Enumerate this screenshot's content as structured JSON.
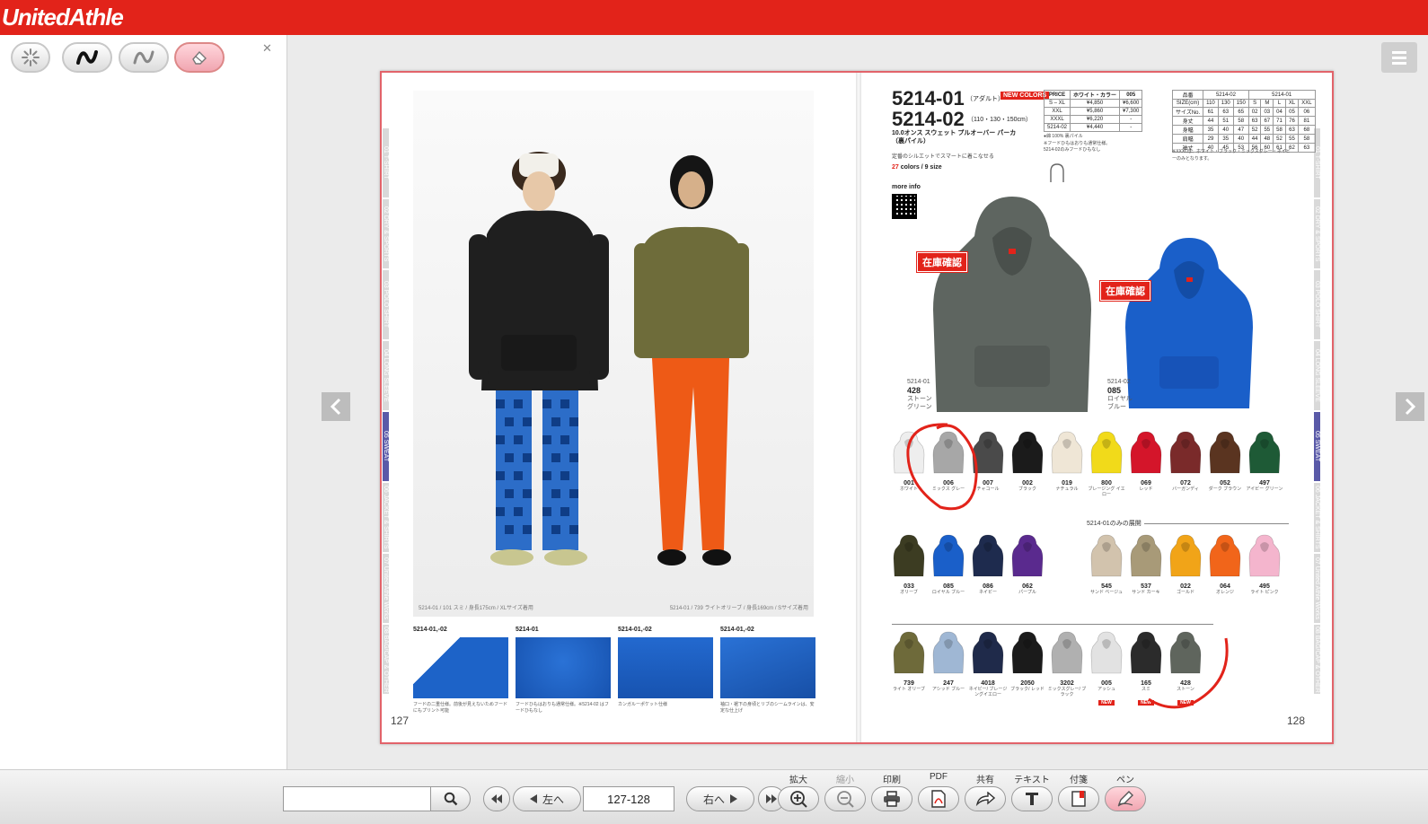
{
  "brand": "UnitedAthle",
  "book": {
    "left_tabs": [
      "01 T-SHIRT",
      "02 DRY & SPORTS",
      "03 POLO SHIRT",
      "04 LONG SLEEVE",
      "05 SWEAT",
      "06 JACKET & SHIRTS",
      "07 United Athle Works",
      "08 BAG/CAP & OTHER"
    ],
    "right_tabs": [
      "01 T-SHIRT",
      "02 DRY & SPORTS",
      "03 POLO SHIRT",
      "04 LONG SLEEVE",
      "05 SWEAT",
      "06 JACKET & SHIRTS",
      "07 United Athle Works",
      "08 BAG/CAP & OTHER"
    ],
    "left_page": {
      "caption_left": "5214-01 / 101 スミ / 身長175cm / XLサイズ着用",
      "caption_right": "5214-01 / 739 ライトオリーブ / 身長169cm / Sサイズ着用",
      "details": [
        {
          "label": "5214-01,-02",
          "text": "フードの二重仕様。前後が見えないためフードにもプリント可能"
        },
        {
          "label": "5214-01",
          "text": "フードひもはおりも通常仕様。※5214-02 はフードひもなし"
        },
        {
          "label": "5214-01,-02",
          "text": "カンガルーポケット仕様"
        },
        {
          "label": "5214-01,-02",
          "text": "袖口・裾下の身頃とリブのシームラインは、安定な仕上げ"
        }
      ],
      "page_number": "127"
    },
    "right_page": {
      "code1": "5214-01",
      "adult": "（アダルト）",
      "new_colors": "NEW COLORS",
      "code2": "5214-02",
      "sizes": "（110・130・150cm）",
      "desc": "10.0オンス スウェット プルオーバー パーカ（裏パイル）",
      "desc2": "定番のシルエットでスマートに着こなせる",
      "colors_count": "27",
      "colors_text": "colors / 9 size",
      "more_info": "more info",
      "price_table": [
        [
          "PRICE",
          "ホワイト・カラー",
          "005"
        ],
        [
          "S – XL",
          "¥4,850",
          "¥6,600"
        ],
        [
          "XXL",
          "¥5,860",
          "¥7,300"
        ],
        [
          "XXXL",
          "¥6,220",
          "-"
        ],
        [
          "5214-02",
          "¥4,440",
          "-"
        ]
      ],
      "notes": [
        "●綿 100% 裏パイル",
        "※フードひもはおりも通常仕様。",
        "5214-02のみフードひもなし"
      ],
      "size_table_header": [
        "品番",
        "5214-02",
        "5214-01"
      ],
      "size_table_rows": [
        [
          "SIZE(cm)",
          "110",
          "130",
          "150",
          "S",
          "M",
          "L",
          "XL",
          "XXL"
        ],
        [
          "サイズNo.",
          "61",
          "63",
          "65",
          "02",
          "03",
          "04",
          "05",
          "06"
        ],
        [
          "身丈",
          "44",
          "51",
          "58",
          "63",
          "67",
          "71",
          "76",
          "81"
        ],
        [
          "身幅",
          "35",
          "40",
          "47",
          "52",
          "55",
          "58",
          "63",
          "68"
        ],
        [
          "肩幅",
          "29",
          "35",
          "40",
          "44",
          "48",
          "52",
          "55",
          "58"
        ],
        [
          "袖丈",
          "40",
          "45",
          "53",
          "56",
          "60",
          "61",
          "62",
          "63"
        ]
      ],
      "size_note": "※XXXLは、ホワイト・ブラック・ミックスグレー・ネイビーのみとなります。",
      "stock_label": "在庫確認",
      "feature_left": {
        "code": "5214-01",
        "num": "428",
        "name": "ストーン グリーン"
      },
      "feature_right": {
        "code": "5214-02",
        "num": "085",
        "name": "ロイヤル ブルー"
      },
      "row1": [
        {
          "num": "001",
          "name": "ホワイト",
          "color": "#eeeeee"
        },
        {
          "num": "006",
          "name": "ミックス グレー",
          "color": "#a7a7a7"
        },
        {
          "num": "007",
          "name": "チャコール",
          "color": "#4a4a4a"
        },
        {
          "num": "002",
          "name": "ブラック",
          "color": "#1b1b1b"
        },
        {
          "num": "019",
          "name": "ナチュラル",
          "color": "#efe6d6"
        },
        {
          "num": "800",
          "name": "ブレージング イエロー",
          "color": "#f1da1a"
        },
        {
          "num": "069",
          "name": "レッド",
          "color": "#d4152a"
        },
        {
          "num": "072",
          "name": "バーガンディ",
          "color": "#7a2a2a"
        },
        {
          "num": "052",
          "name": "ダーク ブラウン",
          "color": "#5a3420"
        },
        {
          "num": "497",
          "name": "アイビー グリーン",
          "color": "#1e5a36"
        }
      ],
      "row2_label": "5214-01のみの展開",
      "row2a": [
        {
          "num": "033",
          "name": "オリーブ",
          "color": "#3c3c22"
        },
        {
          "num": "085",
          "name": "ロイヤル ブルー",
          "color": "#1a5fc9"
        },
        {
          "num": "086",
          "name": "ネイビー",
          "color": "#1e2b4e"
        },
        {
          "num": "062",
          "name": "パープル",
          "color": "#5a2a8e"
        }
      ],
      "row2b": [
        {
          "num": "545",
          "name": "サンド ベージュ",
          "color": "#d2c3ad"
        },
        {
          "num": "537",
          "name": "サンド カーキ",
          "color": "#a89a78"
        },
        {
          "num": "022",
          "name": "ゴールド",
          "color": "#f1a418"
        },
        {
          "num": "064",
          "name": "オレンジ",
          "color": "#f1651a"
        },
        {
          "num": "495",
          "name": "ライト ピンク",
          "color": "#f4b5cd"
        }
      ],
      "row3": [
        {
          "num": "739",
          "name": "ライト オリーブ",
          "color": "#6e6a3a",
          "new": false
        },
        {
          "num": "247",
          "name": "アシッド ブルー",
          "color": "#9fb7d4",
          "new": false
        },
        {
          "num": "4018",
          "name": "ネイビー/ ブレージングイエロー",
          "color": "#1f2a4a",
          "new": false
        },
        {
          "num": "2050",
          "name": "ブラック/ レッド",
          "color": "#1b1b1b",
          "new": false
        },
        {
          "num": "3202",
          "name": "ミックスグレー/ ブラック",
          "color": "#b0b0b0",
          "new": false
        },
        {
          "num": "005",
          "name": "アッシュ",
          "color": "#e2e2e2",
          "new": true
        },
        {
          "num": "165",
          "name": "スミ",
          "color": "#2b2b2b",
          "new": true
        },
        {
          "num": "428",
          "name": "ストーン",
          "color": "#5f655d",
          "new": true
        }
      ],
      "new_badge": "NEW",
      "page_number": "128"
    }
  },
  "toolbar": {
    "search_placeholder": "",
    "prev_label": "左へ",
    "page_value": "127-128",
    "next_label": "右へ",
    "labels": [
      "拡大",
      "縮小",
      "印刷",
      "PDF",
      "共有",
      "テキスト",
      "付箋",
      "ペン"
    ]
  }
}
